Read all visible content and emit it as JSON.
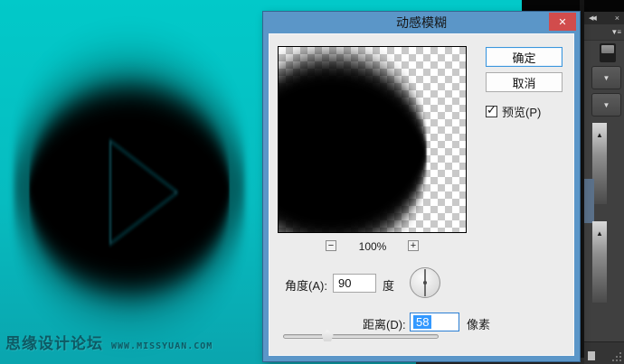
{
  "canvas": {
    "watermark_line1": "思缘设计论坛",
    "watermark_line2": "WWW.MISSYUAN.COM"
  },
  "dialog": {
    "title": "动感模糊",
    "close_glyph": "✕",
    "ok_label": "确定",
    "cancel_label": "取消",
    "preview_label": "预览(P)",
    "preview_check_glyph": "✓",
    "zoom_out_glyph": "−",
    "zoom_level": "100%",
    "zoom_in_glyph": "+",
    "angle_label": "角度(A):",
    "angle_value": "90",
    "angle_unit": "度",
    "angle_degrees": 90,
    "distance_label": "距离(D):",
    "distance_value": "58",
    "distance_unit": "像素",
    "slider_percent": 28
  },
  "panel": {
    "collapse_glyph": "◀◀",
    "close_glyph": "×",
    "menu_glyph": "▼≡",
    "dropdown_glyph": "▼",
    "spinner_glyph": "▲"
  },
  "colors": {
    "canvas_top": "#02c9c9",
    "canvas_bottom": "#0aa5ae",
    "dialog_frame": "#5b96c8",
    "dialog_bg": "#ececec",
    "close_button": "#d14c4c",
    "focus_blue": "#2a7fd4",
    "selection_blue": "#3399ff",
    "panel_bg": "#404040"
  }
}
